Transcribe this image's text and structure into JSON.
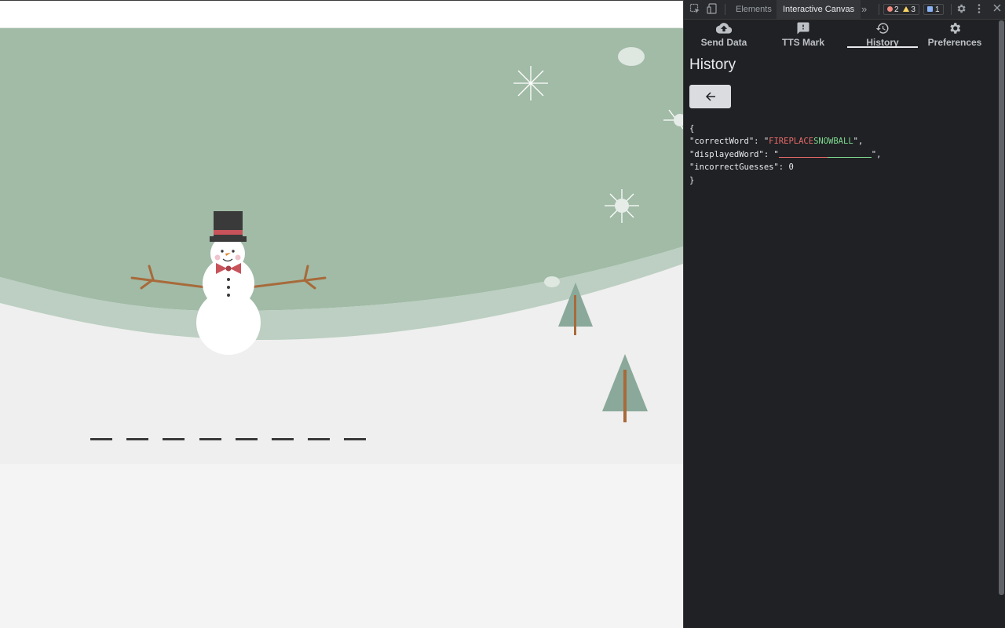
{
  "devtools": {
    "tabs": [
      "Elements",
      "Interactive Canvas"
    ],
    "more_tabs_glyph": "»",
    "errors": "2",
    "warnings": "3",
    "messages": "1"
  },
  "canvas_tabs": [
    {
      "label": "Send Data",
      "icon": "cloud-upload-icon"
    },
    {
      "label": "TTS Mark",
      "icon": "feedback-icon"
    },
    {
      "label": "History",
      "icon": "history-icon"
    },
    {
      "label": "Preferences",
      "icon": "gear-icon"
    }
  ],
  "active_canvas_tab": "History",
  "panel": {
    "title": "History",
    "back_icon": "arrow-left-icon"
  },
  "json_view": {
    "open": "{",
    "close": "}",
    "correct_word_key": "\"correctWord\": \"",
    "correct_word_part1": "FIREPLACE",
    "correct_word_part2": "SNOWBALL",
    "correct_word_end": "\",",
    "displayed_word_key": "\"displayedWord\": \"",
    "displayed_word_end": "\",",
    "incorrect_guesses_key": "\"incorrectGuesses\": ",
    "incorrect_guesses_value": "0"
  },
  "game": {
    "blank_slots": 8
  },
  "colors": {
    "sky": "#a1bba6",
    "hill": "#bccfc2",
    "snow": "#efefef",
    "devtools_bg": "#202124",
    "highlight_red": "#e66a6a",
    "highlight_green": "#7ed991"
  }
}
